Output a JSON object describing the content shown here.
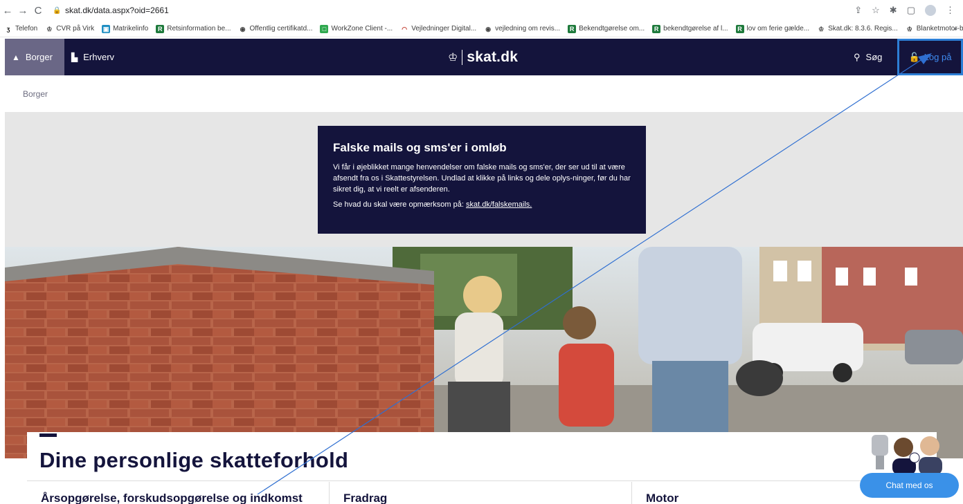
{
  "browser": {
    "url": "skat.dk/data.aspx?oid=2661",
    "bookmarks": [
      "Telefon",
      "CVR på Virk",
      "Matrikelinfo",
      "Retsinformation be...",
      "Offentlig certifikatd...",
      "WorkZone Client -...",
      "Vejledninger Digital...",
      "vejledning om revis...",
      "Bekendtgørelse om...",
      "bekendtgørelse af l...",
      "lov om ferie gælde...",
      "Skat.dk: 8.3.6. Regis...",
      "Blanketmotor-blan..."
    ],
    "more": "»"
  },
  "header": {
    "tab_borger": "Borger",
    "tab_erhverv": "Erhverv",
    "logo": "skat.dk",
    "search": "Søg",
    "login": "Log på"
  },
  "breadcrumb": "Borger",
  "notice": {
    "title": "Falske mails og sms'er i omløb",
    "body": "Vi får i øjeblikket mange henvendelser om falske mails og sms'er, der ser ud til at være afsendt fra os i Skattestyrelsen. Undlad at klikke på links og dele oplys-ninger, før du har sikret dig, at vi reelt er afsenderen.",
    "link_prefix": "Se hvad du skal være opmærksom på:",
    "link": "skat.dk/falskemails."
  },
  "main": {
    "title": "Dine personlige skatteforhold",
    "columns": [
      "Årsopgørelse, forskudsopgørelse og indkomst",
      "Fradrag",
      "Motor"
    ]
  },
  "chat": {
    "label": "Chat med os"
  },
  "colors": {
    "navy": "#14143c",
    "accent_blue": "#3a91e8",
    "notice_band": "#e6e6e6"
  }
}
